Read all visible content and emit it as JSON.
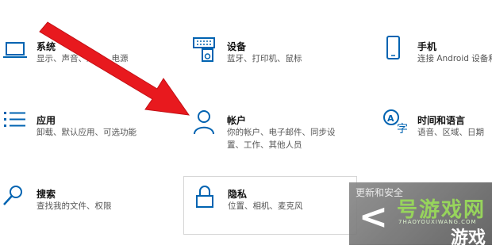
{
  "tiles": [
    {
      "title": "系统",
      "desc1": "显示、声音、通知、电源",
      "desc2": "",
      "icon": "laptop-icon"
    },
    {
      "title": "设备",
      "desc1": "蓝牙、打印机、鼠标",
      "desc2": "",
      "icon": "devices-icon"
    },
    {
      "title": "手机",
      "desc1": "连接 Android 设备和",
      "desc2": "",
      "icon": "phone-icon"
    },
    {
      "title": "应用",
      "desc1": "卸载、默认应用、可选功能",
      "desc2": "",
      "icon": "apps-icon"
    },
    {
      "title": "帐户",
      "desc1": "你的帐户、电子邮件、同步设",
      "desc2": "置、工作、其他人员",
      "icon": "person-icon"
    },
    {
      "title": "时间和语言",
      "desc1": "语音、区域、日期",
      "desc2": "",
      "icon": "time-language-icon"
    },
    {
      "title": "搜索",
      "desc1": "查找我的文件、权限",
      "desc2": "",
      "icon": "search-icon"
    },
    {
      "title": "隐私",
      "desc1": "位置、相机、麦克风",
      "desc2": "",
      "icon": "lock-icon"
    }
  ],
  "watermark": {
    "fragment": "更新和安全",
    "glyph": "<",
    "big": "号游戏网",
    "small": "7HAOYOUXIWANG.COM",
    "big2": "游戏"
  },
  "colors": {
    "accent": "#0063b1",
    "arrow": "#e8191e"
  }
}
